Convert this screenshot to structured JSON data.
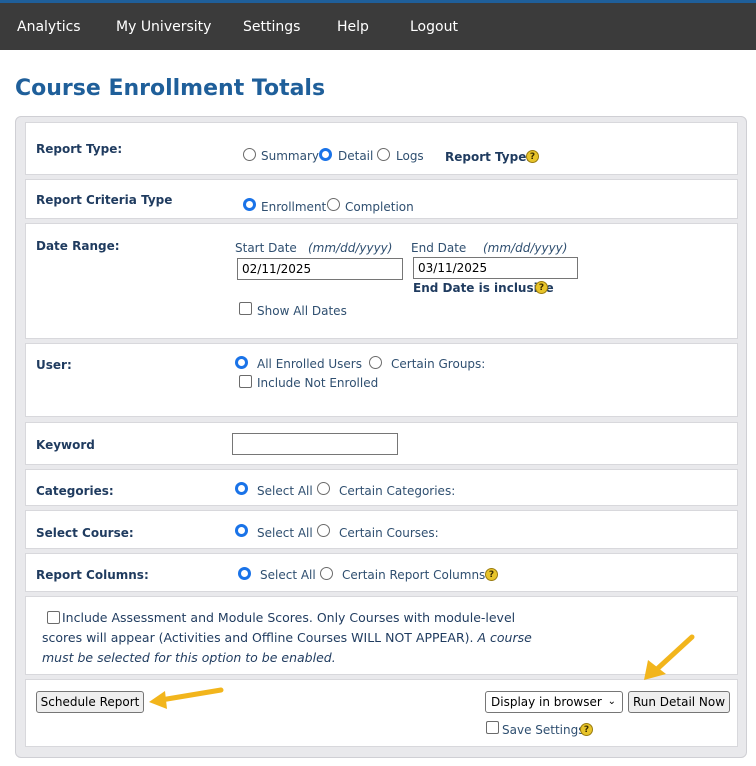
{
  "nav": {
    "items": [
      "Analytics",
      "My University",
      "Settings",
      "Help",
      "Logout"
    ]
  },
  "page": {
    "title": "Course Enrollment Totals"
  },
  "report_type": {
    "label": "Report Type:",
    "options": [
      "Summary",
      "Detail",
      "Logs"
    ],
    "selected": "Detail",
    "help_link": "Report Types"
  },
  "criteria_type": {
    "label": "Report Criteria Type",
    "options": [
      "Enrollment",
      "Completion"
    ],
    "selected": "Enrollment"
  },
  "date_range": {
    "label": "Date Range:",
    "start_label": "Start Date",
    "start_hint": "(mm/dd/yyyy)",
    "start_value": "02/11/2025",
    "end_label": "End Date",
    "end_hint": "(mm/dd/yyyy)",
    "end_value": "03/11/2025",
    "end_note": "End Date is inclusive",
    "show_all_label": "Show All Dates"
  },
  "user": {
    "label": "User:",
    "options": [
      "All Enrolled Users",
      "Certain Groups:"
    ],
    "selected": "All Enrolled Users",
    "include_not_enrolled": "Include Not Enrolled"
  },
  "keyword": {
    "label": "Keyword",
    "value": ""
  },
  "categories": {
    "label": "Categories:",
    "options": [
      "Select All",
      "Certain Categories:"
    ],
    "selected": "Select All"
  },
  "select_course": {
    "label": "Select Course:",
    "options": [
      "Select All",
      "Certain Courses:"
    ],
    "selected": "Select All"
  },
  "report_columns": {
    "label": "Report Columns:",
    "options": [
      "Select All",
      "Certain Report Columns"
    ],
    "selected": "Select All"
  },
  "assessment": {
    "text": "Include Assessment and Module Scores. Only Courses with module-level scores will appear (Activities and Offline Courses WILL NOT APPEAR).",
    "italic": "A course must be selected for this option to be enabled.",
    "line1": "Include Assessment and Module Scores. Only Courses with module-level",
    "line2a": "scores will appear (Activities and Offline Courses WILL NOT APPEAR).",
    "line2b": "A course",
    "line3": "must be selected for this option to be enabled."
  },
  "actions": {
    "schedule_button": "Schedule Report",
    "display_select": "Display in browser",
    "run_button": "Run Detail Now",
    "save_settings": "Save Settings"
  },
  "colors": {
    "topbar": "#3b3b3b",
    "accent": "#1f5f9a",
    "radio_selected": "#1a73e8",
    "help_icon": "#e8c42a",
    "arrow": "#f2b51c"
  }
}
